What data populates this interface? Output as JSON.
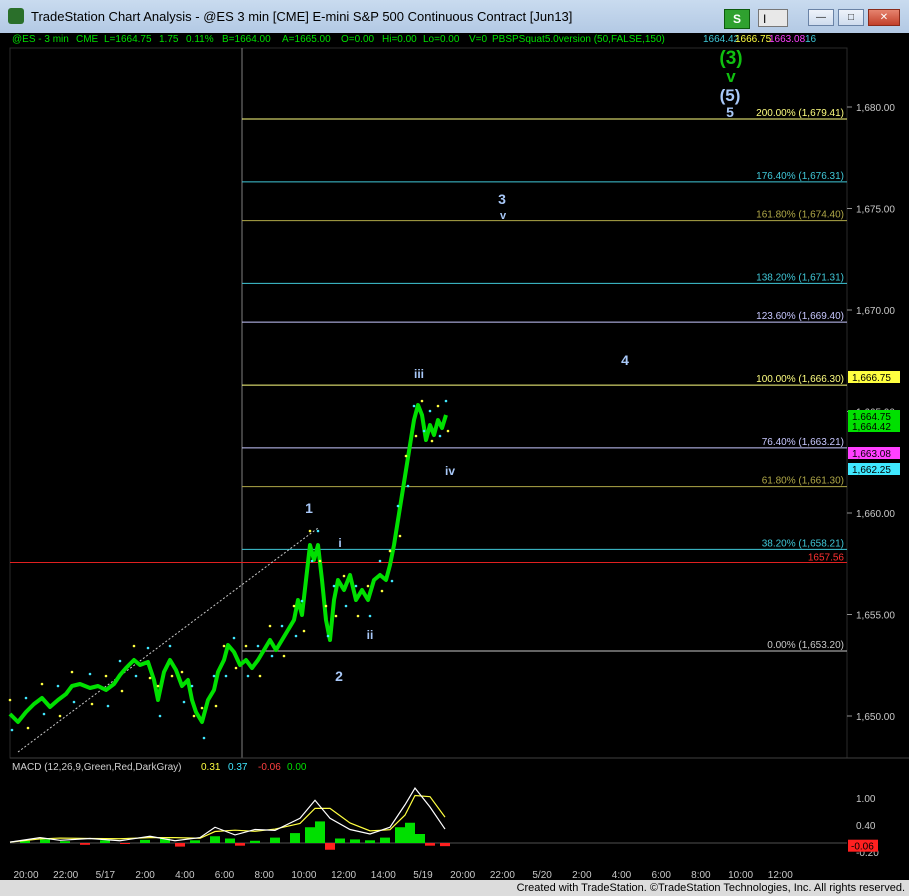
{
  "window": {
    "title": "TradeStation Chart Analysis - @ES 3 min [CME] E-mini S&P 500 Continuous Contract [Jun13]",
    "s_button": "S",
    "i_button": "I",
    "minimize": "—",
    "maximize": "□",
    "close": "✕"
  },
  "infobar": {
    "symbol": "@ES - 3 min",
    "exchange": "CME",
    "last": "L=1664.75",
    "change": "1.75",
    "change_pct": "0.11%",
    "bid": "B=1664.00",
    "ask": "A=1665.00",
    "open": "O=0.00",
    "high": "Hi=0.00",
    "low": "Lo=0.00",
    "volume": "V=0",
    "indicator": "PBSPSquat5.0version (50,FALSE,150)",
    "v1": "1664.42",
    "v2": "1666.75",
    "v3": "1663.08",
    "v4": "16"
  },
  "price_axis": [
    "1,680.00",
    "1,675.00",
    "1,670.00",
    "1,665.00",
    "1,660.00",
    "1,655.00",
    "1,650.00"
  ],
  "price_tags": [
    {
      "text": "1,666.75",
      "bg": "#ffff40",
      "fg": "#000"
    },
    {
      "text": "1,664.75",
      "bg": "#00e000",
      "fg": "#000"
    },
    {
      "text": "1,664.42",
      "bg": "#00e000",
      "fg": "#000"
    },
    {
      "text": "1,663.08",
      "bg": "#ff40ff",
      "fg": "#000"
    },
    {
      "text": "1,662.25",
      "bg": "#40e8ff",
      "fg": "#000"
    }
  ],
  "fib_levels": [
    {
      "label": "200.00% (1,679.41)",
      "color": "#ffff80"
    },
    {
      "label": "176.40% (1,676.31)",
      "color": "#40c8d8"
    },
    {
      "label": "161.80% (1,674.40)",
      "color": "#b0a848"
    },
    {
      "label": "138.20% (1,671.31)",
      "color": "#40c8d8"
    },
    {
      "label": "123.60% (1,669.40)",
      "color": "#c8c8ff"
    },
    {
      "label": "100.00% (1,666.30)",
      "color": "#ffff80"
    },
    {
      "label": "76.40% (1,663.21)",
      "color": "#c8c8ff"
    },
    {
      "label": "61.80% (1,661.30)",
      "color": "#b0a848"
    },
    {
      "label": "38.20% (1,658.21)",
      "color": "#40c8d8"
    },
    {
      "label": "0.00% (1,653.20)",
      "color": "#c8c8c8"
    }
  ],
  "red_level": "1657.56",
  "wave_labels": {
    "big3": "(3)",
    "big_v": "v",
    "five_paren": "(5)",
    "five": "5",
    "three": "3",
    "three_v": "v",
    "four": "4",
    "one": "1",
    "two": "2",
    "i": "i",
    "ii": "ii",
    "iii": "iii",
    "iv": "iv"
  },
  "macd": {
    "label": "MACD (12,26,9,Green,Red,DarkGray)",
    "v1": "0.31",
    "v2": "0.37",
    "v3": "-0.06",
    "v4": "0.00",
    "axis": [
      "1.00",
      "0.40",
      "-0.20"
    ],
    "tag": "-0.06"
  },
  "time_axis": [
    "20:00",
    "22:00",
    "5/17",
    "2:00",
    "4:00",
    "6:00",
    "8:00",
    "10:00",
    "12:00",
    "14:00",
    "5/19",
    "20:00",
    "22:00",
    "5/20",
    "2:00",
    "4:00",
    "6:00",
    "8:00",
    "10:00",
    "12:00"
  ],
  "footer": "Created with TradeStation. ©TradeStation Technologies, Inc. All rights reserved.",
  "colors": {
    "price": "#00e000",
    "macd_line": "#ffffff",
    "signal_line": "#ffff40",
    "hist_pos": "#00e000",
    "hist_neg": "#ff2020",
    "wave": "#a8c8f8",
    "wave_green": "#10c010"
  }
}
